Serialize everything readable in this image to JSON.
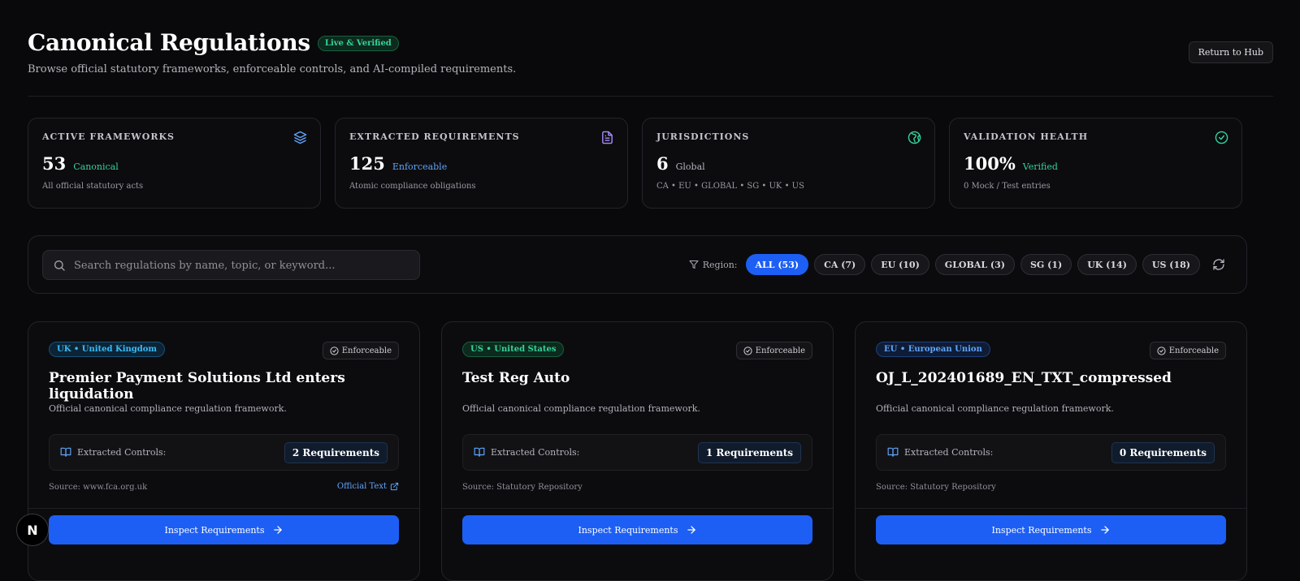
{
  "header": {
    "title": "Canonical Regulations",
    "status_badge": "Live & Verified",
    "subtitle": "Browse official statutory frameworks, enforceable controls, and AI-compiled requirements.",
    "return_button": "Return to Hub"
  },
  "stats": [
    {
      "label": "ACTIVE FRAMEWORKS",
      "value": "53",
      "tag": "Canonical",
      "note": "All official statutory acts",
      "icon": "layers-icon",
      "tag_color": "#34d399"
    },
    {
      "label": "EXTRACTED REQUIREMENTS",
      "value": "125",
      "tag": "Enforceable",
      "note": "Atomic compliance obligations",
      "icon": "document-icon",
      "tag_color": "#60a5fa"
    },
    {
      "label": "JURISDICTIONS",
      "value": "6",
      "tag": "Global",
      "note": "CA • EU • GLOBAL • SG • UK • US",
      "icon": "globe-icon",
      "tag_color": "#b4b4bc"
    },
    {
      "label": "VALIDATION HEALTH",
      "value": "100%",
      "tag": "Verified",
      "note": "0 Mock / Test entries",
      "icon": "check-circle-icon",
      "tag_color": "#34d399"
    }
  ],
  "search": {
    "placeholder": "Search regulations by name, topic, or keyword...",
    "value": ""
  },
  "filter": {
    "label": "Region:",
    "chips": [
      "ALL (53)",
      "CA (7)",
      "EU (10)",
      "GLOBAL (3)",
      "SG (1)",
      "UK (14)",
      "US (18)"
    ],
    "selected": "ALL (53)"
  },
  "cards": [
    {
      "region": "UK • United Kingdom",
      "status": "Enforceable",
      "title": "Premier Payment Solutions Ltd enters liquidation",
      "description": "Official canonical compliance regulation framework.",
      "controls_label": "Extracted Controls:",
      "requirements": "2 Requirements",
      "source": "Source: www.fca.org.uk",
      "link": "Official Text",
      "button": "Inspect Requirements"
    },
    {
      "region": "US • United States",
      "status": "Enforceable",
      "title": "Test Reg Auto",
      "description": "Official canonical compliance regulation framework.",
      "controls_label": "Extracted Controls:",
      "requirements": "1 Requirements",
      "source": "Source: Statutory Repository",
      "button": "Inspect Requirements"
    },
    {
      "region": "EU • European Union",
      "status": "Enforceable",
      "title": "OJ_L_202401689_EN_TXT_compressed",
      "description": "Official canonical compliance regulation framework.",
      "controls_label": "Extracted Controls:",
      "requirements": "0 Requirements",
      "source": "Source: Statutory Repository",
      "button": "Inspect Requirements"
    }
  ],
  "colors": {
    "accent": "#1d5ff5",
    "success": "#34d399",
    "info": "#60a5fa",
    "region_uk": "#38bdf8",
    "region_us": "#34d399",
    "region_eu": "#60a5fa"
  },
  "floating_badge": "N"
}
